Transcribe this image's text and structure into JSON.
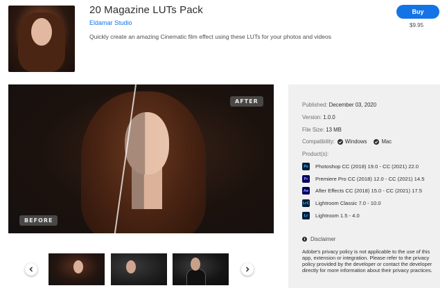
{
  "product": {
    "title": "20 Magazine LUTs Pack",
    "studio": "Eldamar Studio",
    "description": "Quickly create an amazing Cinematic film effect using these LUTs for your photos and videos",
    "buy_label": "Buy",
    "price": "$9.95"
  },
  "hero": {
    "after_label": "AFTER",
    "before_label": "BEFORE"
  },
  "details": {
    "published_label": "Published:",
    "published_value": "December 03, 2020",
    "version_label": "Version:",
    "version_value": "1.0.0",
    "size_label": "File Size:",
    "size_value": "13 MB",
    "compat_label": "Compatibility:",
    "compat": [
      "Windows",
      "Mac"
    ],
    "products_label": "Product(s):",
    "products": [
      {
        "badge": "Ps",
        "icon": "photoshop-icon",
        "name": "Photoshop CC (2018) 19.0 - CC (2021) 22.0"
      },
      {
        "badge": "Pr",
        "icon": "premiere-pro-icon",
        "name": "Premiere Pro CC (2018) 12.0 - CC (2021) 14.5"
      },
      {
        "badge": "Ae",
        "icon": "after-effects-icon",
        "name": "After Effects CC (2018) 15.0 - CC (2021) 17.5"
      },
      {
        "badge": "LrC",
        "icon": "lightroom-classic-icon",
        "name": "Lightroom Classic 7.0 - 10.0"
      },
      {
        "badge": "Lr",
        "icon": "lightroom-icon",
        "name": "Lightroom 1.5 - 4.0"
      }
    ],
    "disclaimer_heading": "Disclaimer",
    "disclaimer_text": "Adobe's privacy policy is not applicable to the use of this app, extension or integration. Please refer to the privacy policy provided by the developer or contact the developer directly for more information about their privacy practices."
  },
  "colors": {
    "accent": "#1473e6",
    "panel": "#f0f0f0"
  }
}
